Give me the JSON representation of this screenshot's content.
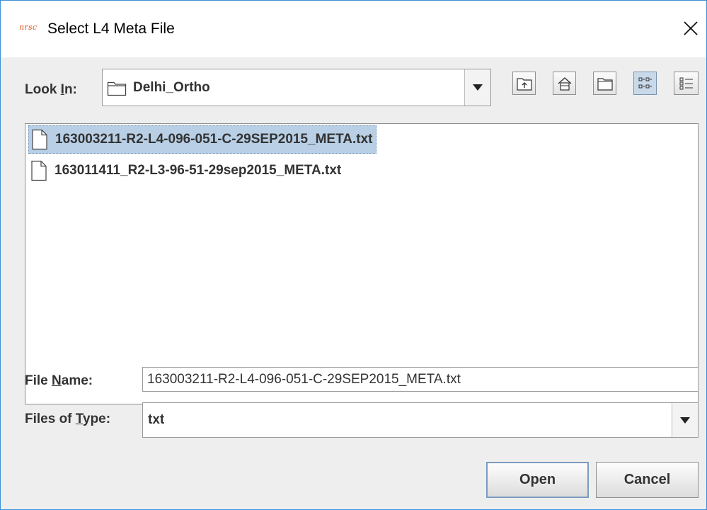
{
  "window": {
    "app_logo": "nrsc",
    "title": "Select L4 Meta File"
  },
  "look_in": {
    "label_pre": "Look ",
    "label_mnemonic": "I",
    "label_post": "n:",
    "value": "Delhi_Ortho"
  },
  "toolbar": {
    "icons": [
      "up-folder-icon",
      "home-icon",
      "new-folder-icon",
      "list-view-icon",
      "details-view-icon"
    ],
    "active": "list-view"
  },
  "files": [
    {
      "name": "163003211-R2-L4-096-051-C-29SEP2015_META.txt",
      "selected": true
    },
    {
      "name": "163011411_R2-L3-96-51-29sep2015_META.txt",
      "selected": false
    }
  ],
  "file_name": {
    "label_pre": "File ",
    "label_mnemonic": "N",
    "label_post": "ame:",
    "value": "163003211-R2-L4-096-051-C-29SEP2015_META.txt"
  },
  "file_type": {
    "label_pre": "Files of ",
    "label_mnemonic": "T",
    "label_post": "ype:",
    "value": "txt"
  },
  "buttons": {
    "open": "Open",
    "cancel": "Cancel"
  },
  "colors": {
    "window_border": "#3c8fd6",
    "selection": "#b8cfe5",
    "logo": "#e0561a"
  }
}
